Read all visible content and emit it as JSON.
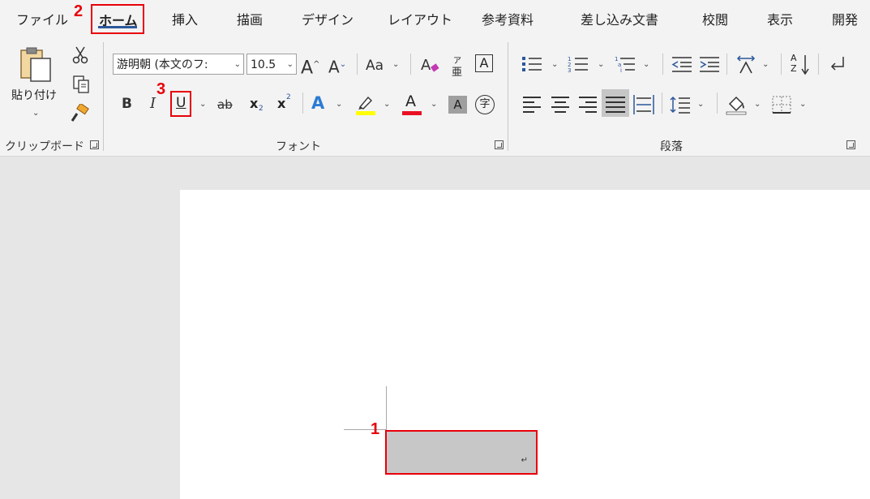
{
  "tabs": [
    "ファイル",
    "ホーム",
    "挿入",
    "描画",
    "デザイン",
    "レイアウト",
    "参考資料",
    "差し込み文書",
    "校閲",
    "表示",
    "開発"
  ],
  "clipboard": {
    "paste_label": "貼り付け",
    "group_label": "クリップボード"
  },
  "font": {
    "name": "游明朝 (本文のフ:",
    "size": "10.5",
    "change_case": "Aa",
    "phonetic_top": "ア",
    "phonetic_bottom": "亜",
    "border_char": "A",
    "bold": "B",
    "italic": "I",
    "underline": "U",
    "strikethrough": "ab",
    "subscript": "x",
    "subscript_mark": "2",
    "superscript": "x",
    "superscript_mark": "2",
    "text_effect": "A",
    "font_color": "A",
    "char_shading": "A",
    "enclose_char": "字",
    "group_label": "フォント"
  },
  "paragraph": {
    "group_label": "段落",
    "sort_a": "A",
    "sort_z": "Z"
  },
  "markers": [
    "1",
    "2",
    "3"
  ],
  "document": {
    "paragraph_mark": "↵"
  },
  "colors": {
    "accent": "#2b579a",
    "annotation": "#e8000a",
    "highlight": "#ffff00",
    "font_color": "#e81123",
    "selection": "#c7c7c7"
  }
}
